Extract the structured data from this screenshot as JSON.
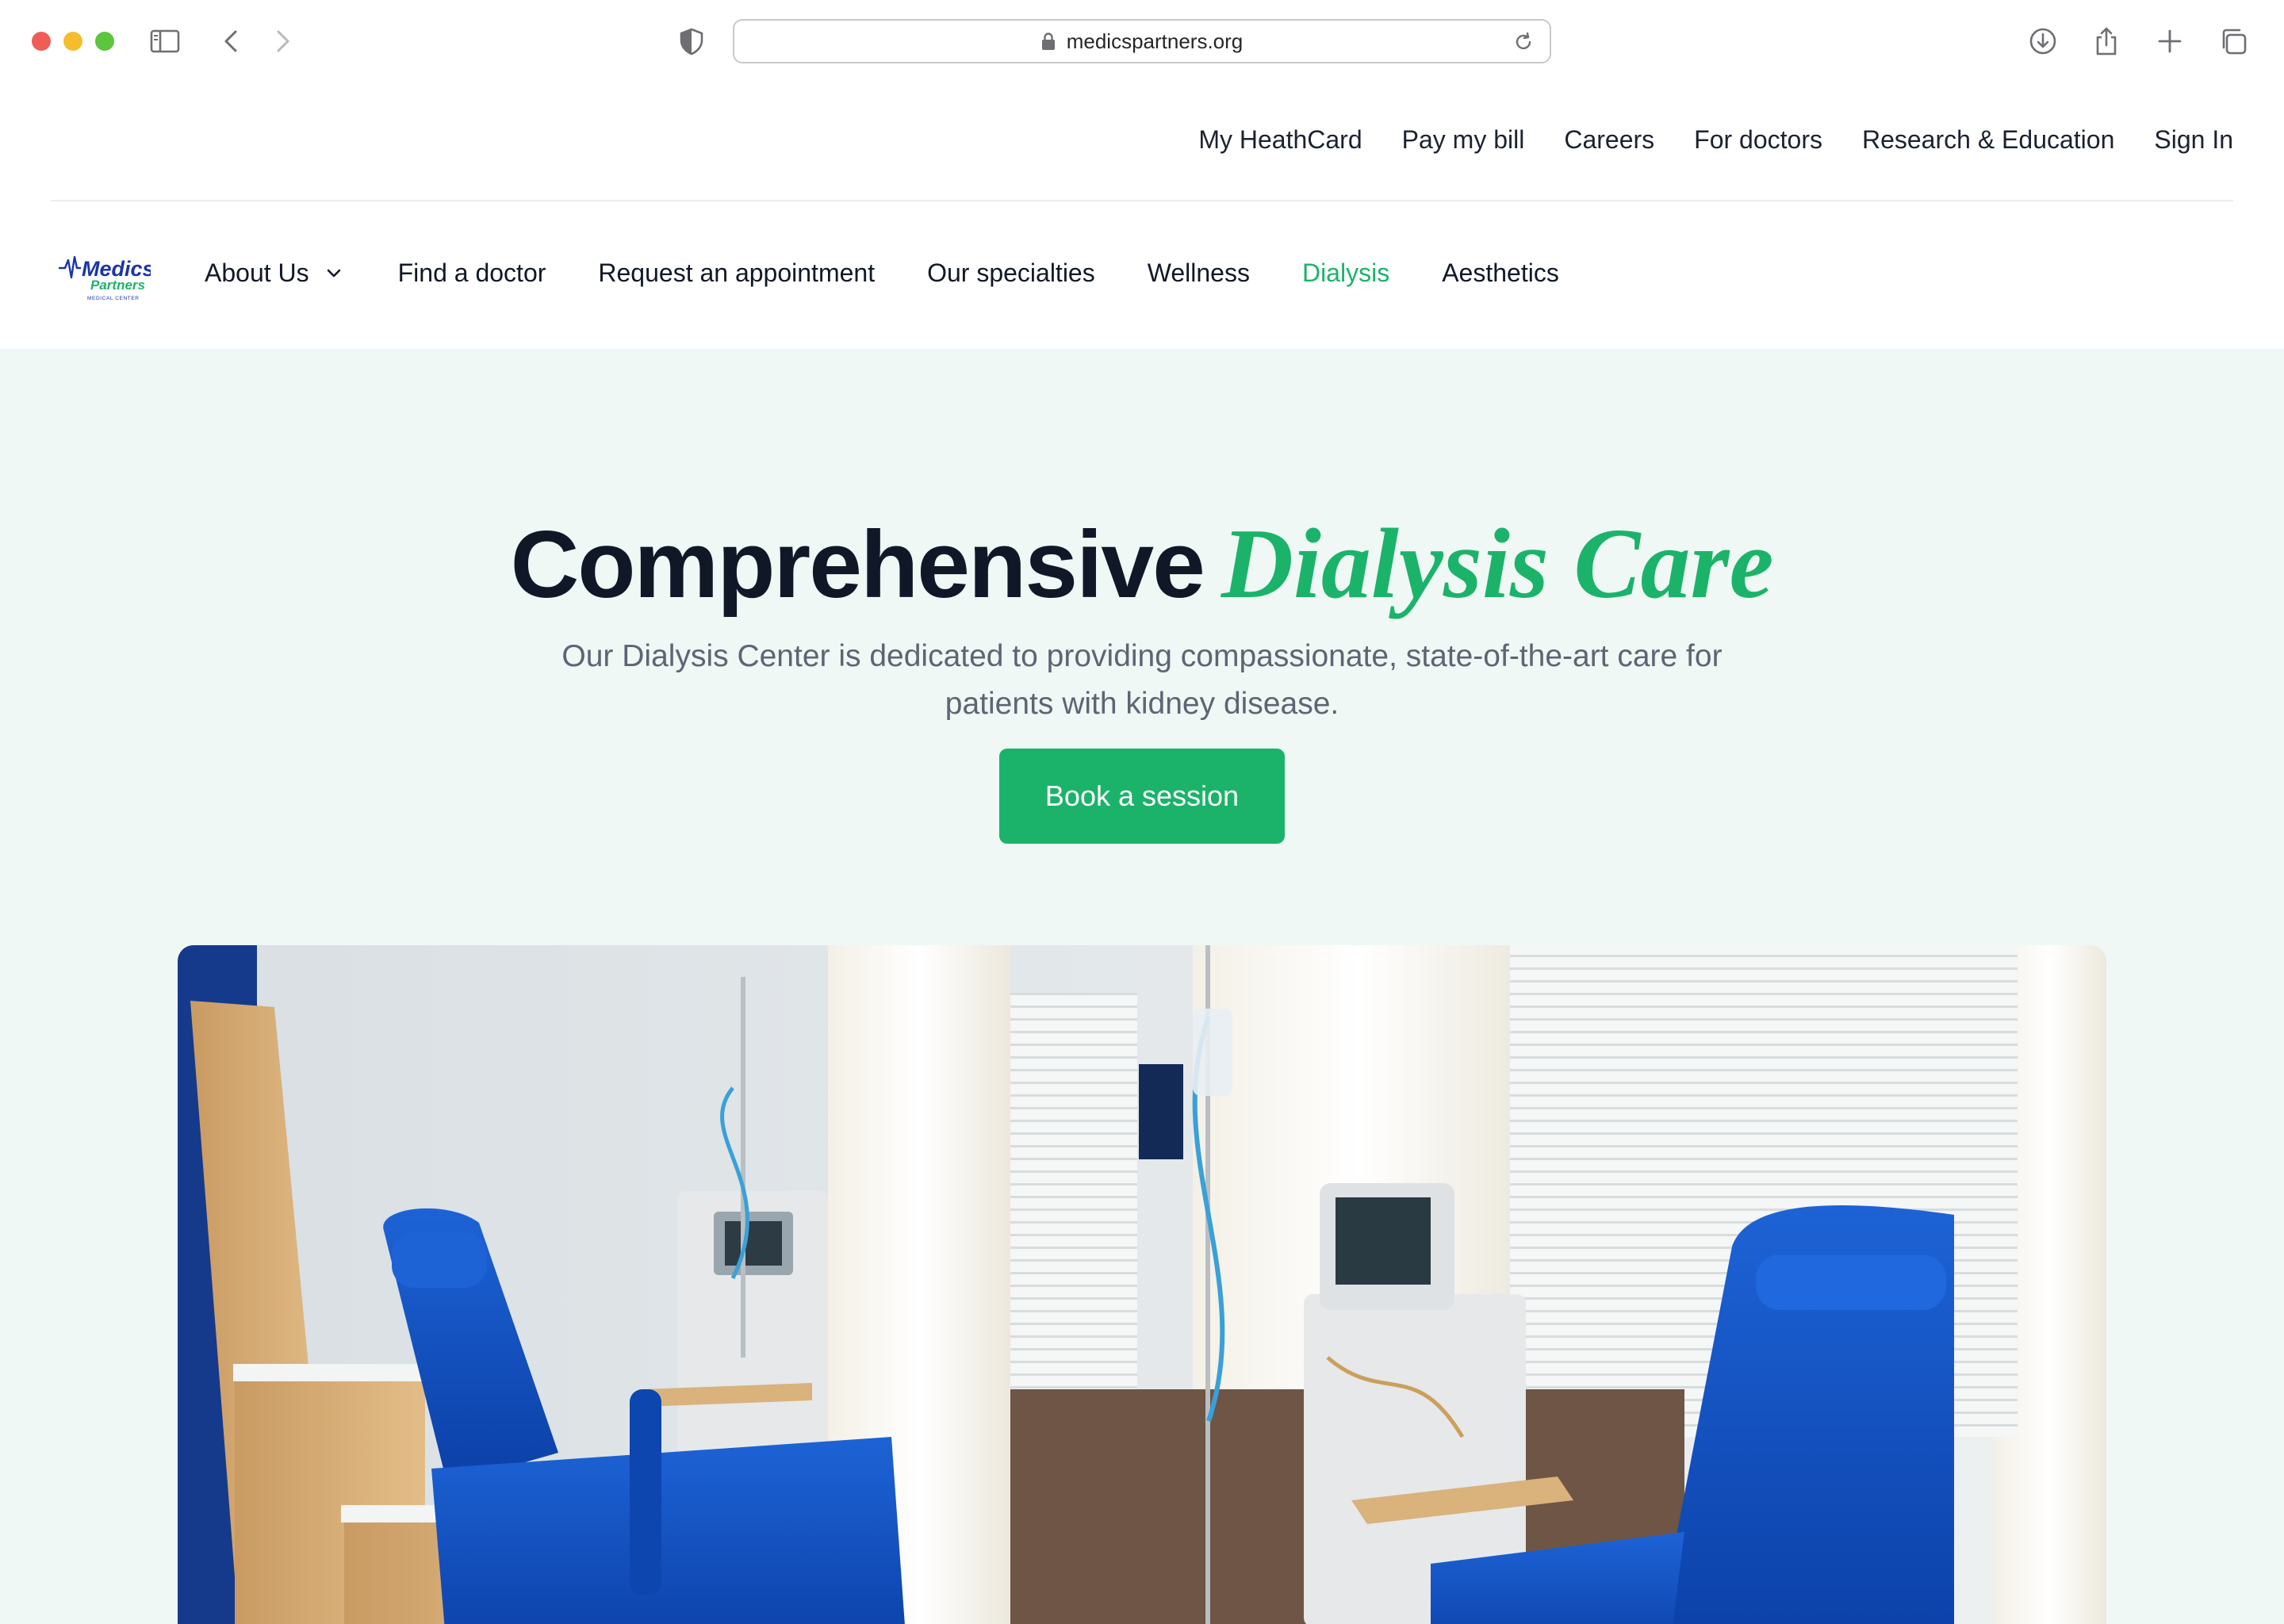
{
  "browser": {
    "url": "medicspartners.org",
    "colors": {
      "close": "#ee5e57",
      "minimize": "#f5bd2e",
      "zoom": "#5ec53f"
    },
    "icons": [
      "sidebar-icon",
      "back-icon",
      "forward-icon",
      "privacy-shield-icon",
      "lock-icon",
      "reload-icon",
      "download-icon",
      "share-icon",
      "new-tab-icon",
      "tabs-overview-icon"
    ]
  },
  "utility_nav": {
    "items": [
      "My HeathCard",
      "Pay my bill",
      "Careers",
      "For doctors",
      "Research & Education",
      "Sign In"
    ]
  },
  "main_nav": {
    "logo": {
      "line1": "Medics",
      "line2": "Partners",
      "line3": "MEDICAL CENTER"
    },
    "items": [
      {
        "label": "About Us",
        "has_dropdown": true
      },
      {
        "label": "Find a doctor"
      },
      {
        "label": "Request an appointment"
      },
      {
        "label": "Our specialties"
      },
      {
        "label": "Wellness"
      },
      {
        "label": "Dialysis",
        "active": true
      },
      {
        "label": "Aesthetics"
      }
    ]
  },
  "hero": {
    "title_main": "Comprehensive",
    "title_accent": "Dialysis Care",
    "subtitle": "Our Dialysis Center is dedicated to providing compassionate, state-of-the-art care for patients with kidney disease.",
    "cta_label": "Book a session"
  },
  "colors": {
    "accent": "#1bb36a",
    "hero_bg": "#eff8f5",
    "heading": "#101828",
    "body_text": "#5f6474"
  }
}
